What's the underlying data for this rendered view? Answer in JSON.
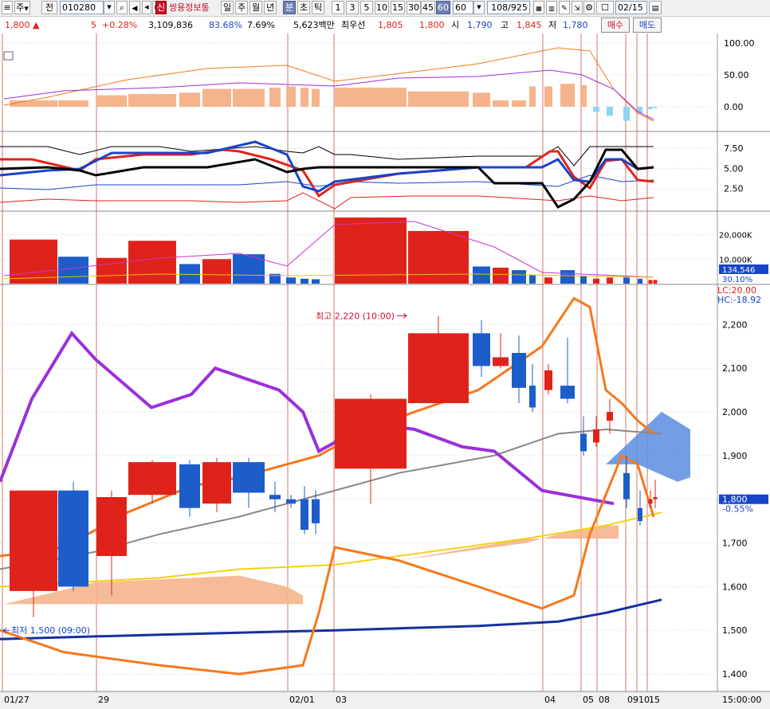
{
  "toolbar": {
    "market": "주",
    "market_icon": "caret-down-icon",
    "jeon": "전",
    "code": "010280",
    "stock_name": "쌍용정보통",
    "name_badge": "신",
    "periods": [
      "일",
      "주",
      "월",
      "년",
      "분",
      "초",
      "틱"
    ],
    "selected_period": "분",
    "intervals": [
      "1",
      "3",
      "5",
      "10",
      "15",
      "30",
      "45",
      "60"
    ],
    "selected_interval": "60",
    "interval_value": "60",
    "record_counter": "108/925",
    "date": "02/15"
  },
  "quote": {
    "price": "1,800",
    "change": "5",
    "change_pct": "+0.28%",
    "volume": "3,109,836",
    "pct1": "83.68%",
    "pct2": "7.69%",
    "amount": "5,623백만",
    "best_label": "최우선",
    "best_ask": "1,805",
    "best_bid": "1,800",
    "open_label": "시",
    "open": "1,790",
    "high_label": "고",
    "high": "1,845",
    "low_label": "저",
    "low": "1,780",
    "buy_label": "매수",
    "sell_label": "매도"
  },
  "panels": {
    "p1_ticks": [
      "100.00",
      "50.00",
      "0.00"
    ],
    "p2_ticks": [
      "7.50",
      "5.00",
      "2.50"
    ],
    "p3_ticks": [
      "20,000K",
      "10,000K"
    ],
    "p3_value": "134,546",
    "p3_pct": "30.10%",
    "p4_ticks": [
      "2,200",
      "2,100",
      "2,000",
      "1,900",
      "1,800",
      "1,700",
      "1,600",
      "1,500",
      "1,400"
    ],
    "lc": "LC:20.00",
    "hc": "HC:-18.92",
    "cur_price": "1,800",
    "cur_pct": "-0.55%",
    "high_annot": "최고 2,220 (10:00)",
    "low_annot": "최저 1,500 (09:00)",
    "x_labels": [
      {
        "text": "01/27",
        "idx": 0
      },
      {
        "text": "29",
        "idx": 1
      },
      {
        "text": "02/01",
        "idx": 2
      },
      {
        "text": "03",
        "idx": 3
      },
      {
        "text": "04",
        "idx": 4
      },
      {
        "text": "05",
        "idx": 5
      },
      {
        "text": "08",
        "idx": 6
      },
      {
        "text": "09",
        "idx": 7
      },
      {
        "text": "10",
        "idx": 8
      },
      {
        "text": "15",
        "idx": 9
      }
    ],
    "time_label": "15:00:00"
  },
  "colors": {
    "up": "#e0231a",
    "down": "#1c5dc9",
    "purple": "#9b30d9",
    "orange": "#f5781e",
    "navy": "#1530a0",
    "yellow": "#f5d010",
    "salmon": "#f5b48c",
    "grid": "#c0392b"
  },
  "chart_data": {
    "type": "candlestick",
    "y_range": [
      1360,
      2290
    ],
    "candles": [
      {
        "o": 1590,
        "h": 1640,
        "l": 1530,
        "c": 1820
      },
      {
        "o": 1820,
        "h": 1840,
        "l": 1590,
        "c": 1600
      },
      {
        "o": 1670,
        "h": 1820,
        "l": 1580,
        "c": 1805
      },
      {
        "o": 1810,
        "h": 1890,
        "l": 1790,
        "c": 1885
      },
      {
        "o": 1880,
        "h": 1890,
        "l": 1760,
        "c": 1780
      },
      {
        "o": 1790,
        "h": 1895,
        "l": 1770,
        "c": 1885
      },
      {
        "o": 1885,
        "h": 1895,
        "l": 1780,
        "c": 1815
      },
      {
        "o": 1810,
        "h": 1840,
        "l": 1770,
        "c": 1800
      },
      {
        "o": 1800,
        "h": 1810,
        "l": 1780,
        "c": 1790
      },
      {
        "o": 1800,
        "h": 1830,
        "l": 1720,
        "c": 1730
      },
      {
        "o": 1800,
        "h": 1820,
        "l": 1720,
        "c": 1745
      },
      {
        "o": 1870,
        "h": 2040,
        "l": 1790,
        "c": 2030
      },
      {
        "o": 2020,
        "h": 2220,
        "l": 2020,
        "c": 2180
      },
      {
        "o": 2180,
        "h": 2210,
        "l": 2080,
        "c": 2105
      },
      {
        "o": 2105,
        "h": 2180,
        "l": 2100,
        "c": 2125
      },
      {
        "o": 2135,
        "h": 2175,
        "l": 2020,
        "c": 2055
      },
      {
        "o": 2060,
        "h": 2110,
        "l": 2000,
        "c": 2010
      },
      {
        "o": 2050,
        "h": 2110,
        "l": 2040,
        "c": 2095
      },
      {
        "o": 2060,
        "h": 2170,
        "l": 2020,
        "c": 2030
      },
      {
        "o": 1950,
        "h": 1990,
        "l": 1900,
        "c": 1910
      },
      {
        "o": 1930,
        "h": 1990,
        "l": 1920,
        "c": 1960
      },
      {
        "o": 1980,
        "h": 2030,
        "l": 1950,
        "c": 2000
      },
      {
        "o": 1860,
        "h": 1900,
        "l": 1780,
        "c": 1800
      },
      {
        "o": 1780,
        "h": 1820,
        "l": 1740,
        "c": 1750
      },
      {
        "o": 1790,
        "h": 1820,
        "l": 1780,
        "c": 1800
      },
      {
        "o": 1800,
        "h": 1845,
        "l": 1780,
        "c": 1805
      }
    ],
    "volumes": [
      18000,
      11000,
      10500,
      17500,
      8000,
      10000,
      12000,
      4000,
      2500,
      2000,
      1800,
      27000,
      21500,
      7000,
      6500,
      5500,
      3500,
      2500,
      5500,
      3000,
      2000,
      2500,
      2500,
      2000,
      1500,
      1500
    ]
  }
}
